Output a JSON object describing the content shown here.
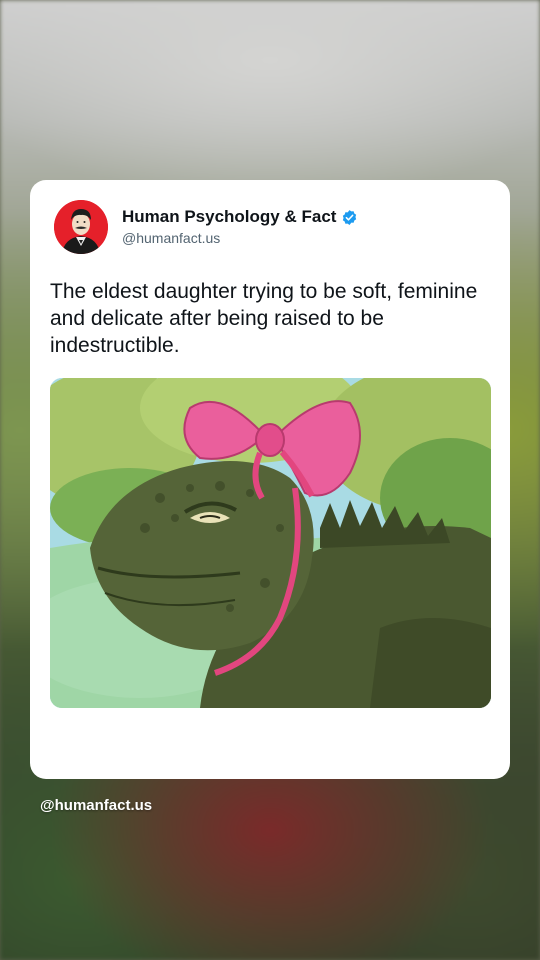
{
  "post": {
    "account_name": "Human Psychology & Fact",
    "handle": "@humanfact.us",
    "verified": true,
    "text": "The eldest daughter trying to be soft, feminine and delicate after being raised to be indestructible.",
    "media": {
      "description_icon": "cartoon-lizard-with-pink-bow"
    }
  },
  "watermark": "@humanfact.us",
  "colors": {
    "verified_blue": "#1d9bf0",
    "avatar_red": "#e5202a",
    "bow_pink": "#ea5f9c",
    "lizard_green": "#4e5b33"
  }
}
